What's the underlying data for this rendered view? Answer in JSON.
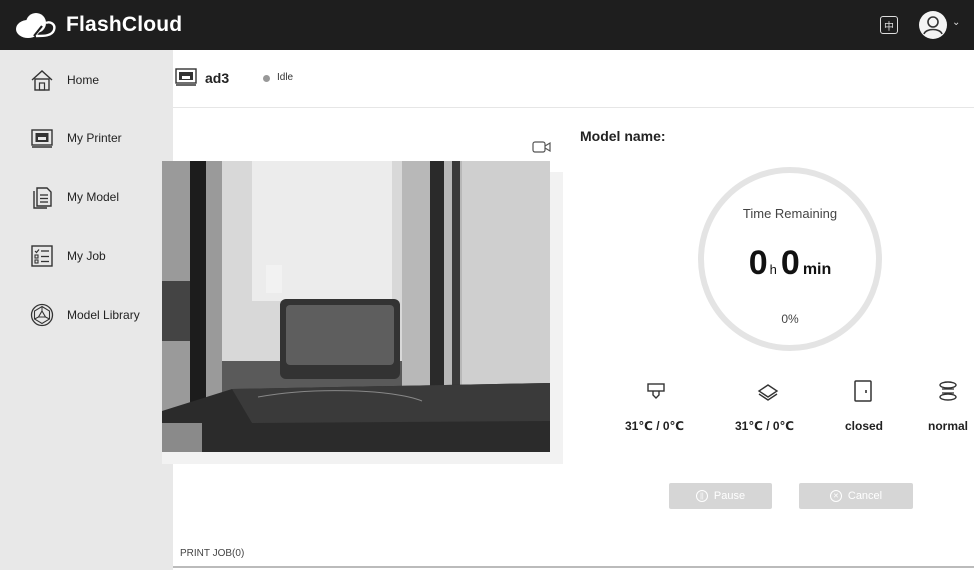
{
  "app": {
    "name": "FlashCloud",
    "language_icon": "中"
  },
  "sidebar": {
    "items": [
      {
        "label": "Home",
        "icon": "home-icon"
      },
      {
        "label": "My Printer",
        "icon": "printer-icon"
      },
      {
        "label": "My Model",
        "icon": "model-icon"
      },
      {
        "label": "My Job",
        "icon": "job-list-icon"
      },
      {
        "label": "Model Library",
        "icon": "model-library-icon"
      }
    ]
  },
  "printer": {
    "name": "ad3",
    "status": "Idle"
  },
  "job": {
    "model_name_label": "Model name:",
    "model_name": "",
    "time_label": "Time Remaining",
    "hours": "0",
    "hours_unit": "h",
    "minutes": "0",
    "minutes_unit": "min",
    "progress": "0%"
  },
  "stats": {
    "nozzle_temp": "31℃ / 0℃",
    "bed_temp": "31℃ / 0℃",
    "door": "closed",
    "filament": "normal"
  },
  "buttons": {
    "pause": "Pause",
    "cancel": "Cancel"
  },
  "footer": {
    "print_job": "PRINT JOB(0)"
  },
  "colors": {
    "topbar": "#1e1e1e",
    "sidebar": "#e8e8e8",
    "disabled_button": "#d6d6d6"
  }
}
